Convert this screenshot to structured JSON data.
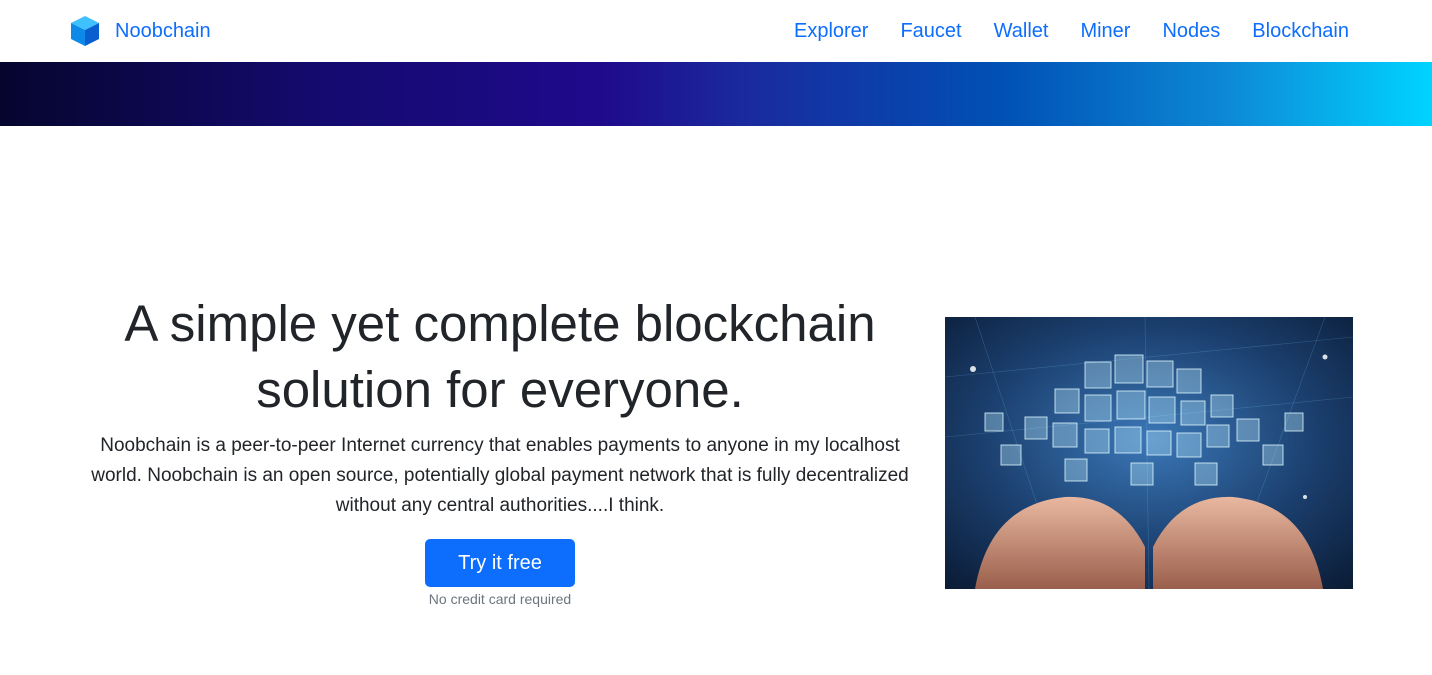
{
  "brand": {
    "name": "Noobchain",
    "logo_icon": "cube-icon",
    "color": "#0d6efd"
  },
  "nav": {
    "items": [
      {
        "label": "Explorer"
      },
      {
        "label": "Faucet"
      },
      {
        "label": "Wallet"
      },
      {
        "label": "Miner"
      },
      {
        "label": "Nodes"
      },
      {
        "label": "Blockchain"
      }
    ]
  },
  "hero": {
    "headline_line1": "A simple yet complete blockchain",
    "headline_line2": "solution for everyone.",
    "lead_line1": "Noobchain is a peer-to-peer Internet currency that enables payments to anyone in my localhost",
    "lead_line2": "world. Noobchain is an open source, potentially global payment network that is fully decentralized",
    "lead_line3": "without any central authorities....I think.",
    "cta_label": "Try it free",
    "cta_note": "No credit card required",
    "cta_color": "#0d6efd",
    "image_icon": "blockchain-hands-illustration"
  },
  "colors": {
    "band_start": "#06052e",
    "band_mid": "#1f0a8c",
    "band_end": "#00d4ff"
  }
}
